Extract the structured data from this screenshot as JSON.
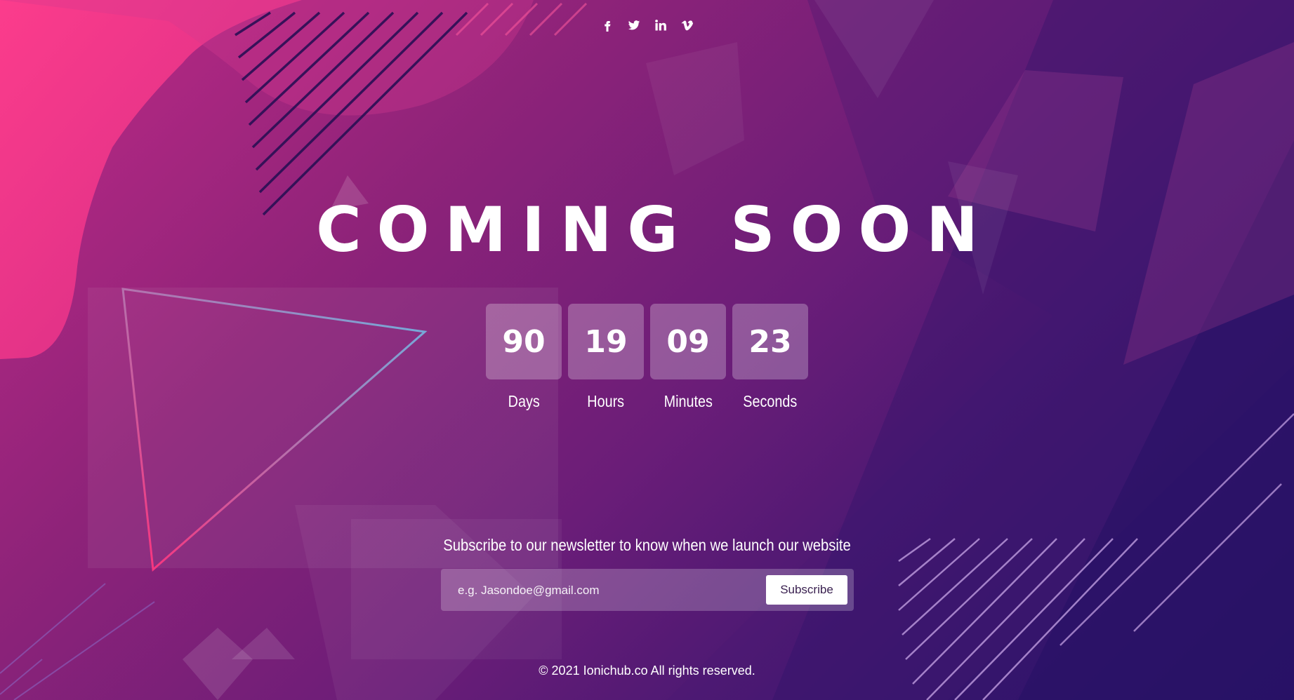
{
  "social": {
    "icons": [
      "facebook-icon",
      "twitter-icon",
      "linkedin-icon",
      "vimeo-icon"
    ]
  },
  "hero": {
    "title": "COMING SOON"
  },
  "countdown": [
    {
      "value": "90",
      "label": "Days"
    },
    {
      "value": "19",
      "label": "Hours"
    },
    {
      "value": "09",
      "label": "Minutes"
    },
    {
      "value": "23",
      "label": "Seconds"
    }
  ],
  "newsletter": {
    "text": "Subscribe to our newsletter to know when we launch our website",
    "placeholder": "e.g. Jasondoe@gmail.com",
    "button_label": "Subscribe"
  },
  "footer": {
    "copyright": "© 2021 Ionichub.co All rights reserved."
  },
  "colors": {
    "bg_pink": "#e5327f",
    "bg_purple": "#6a1d78",
    "bg_navy": "#2a1366",
    "text": "#ffffff",
    "button_text": "#3a2150"
  }
}
